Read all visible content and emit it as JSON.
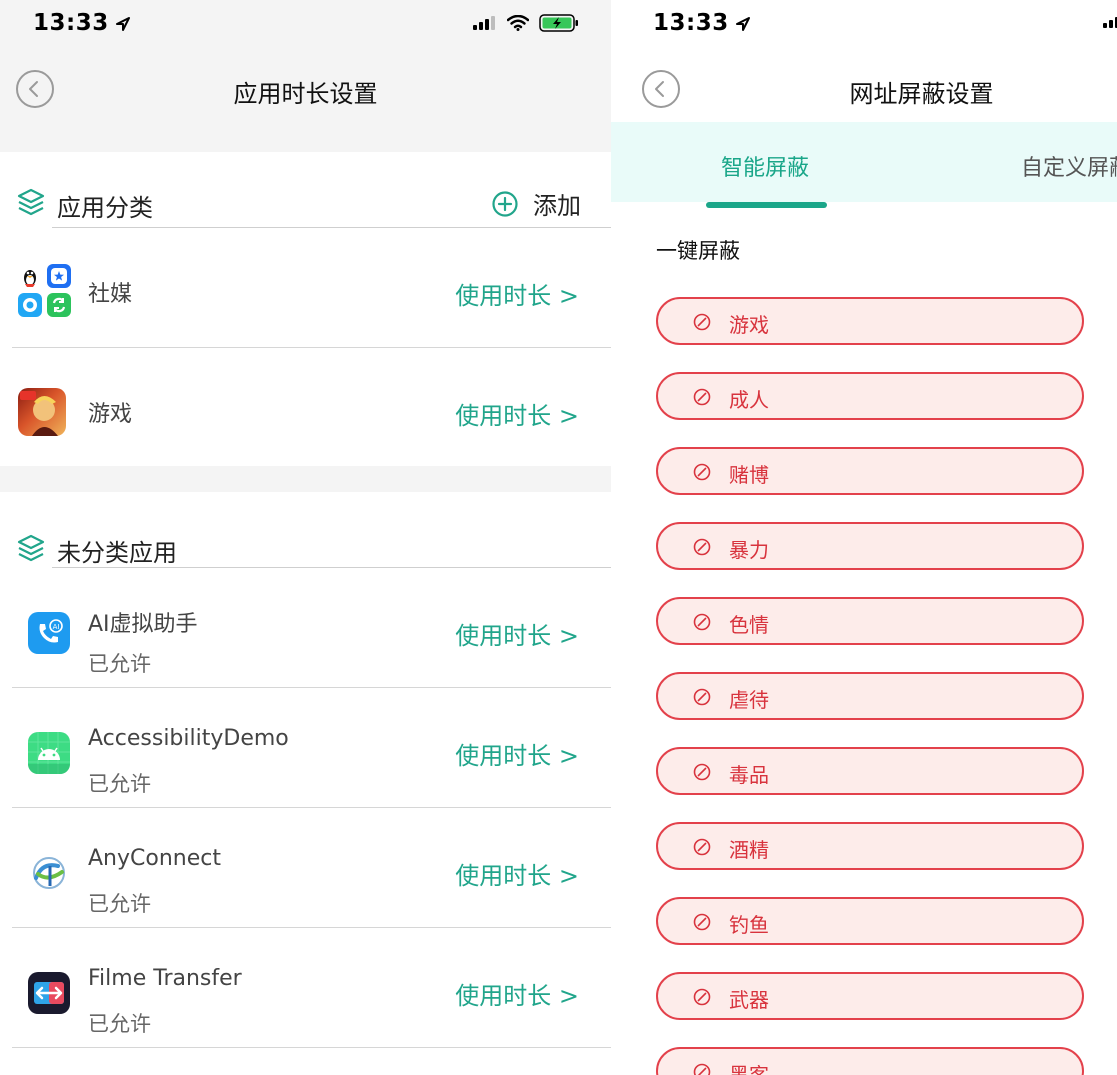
{
  "status": {
    "time": "13:33"
  },
  "left": {
    "title": "应用时长设置",
    "categorized": {
      "title": "应用分类",
      "add_label": "添加",
      "rows": [
        {
          "name": "社媒",
          "action": "使用时长 >"
        },
        {
          "name": "游戏",
          "action": "使用时长 >"
        }
      ]
    },
    "uncategorized": {
      "title": "未分类应用",
      "rows": [
        {
          "name": "AI虚拟助手",
          "status": "已允许",
          "action": "使用时长 >"
        },
        {
          "name": "AccessibilityDemo",
          "status": "已允许",
          "action": "使用时长 >"
        },
        {
          "name": "AnyConnect",
          "status": "已允许",
          "action": "使用时长 >"
        },
        {
          "name": "Filme Transfer",
          "status": "已允许",
          "action": "使用时长 >"
        }
      ]
    }
  },
  "right": {
    "title": "网址屏蔽设置",
    "tabs": [
      "智能屏蔽",
      "自定义屏蔽"
    ],
    "section_label": "一键屏蔽",
    "chips": [
      "游戏",
      "成人",
      "赌博",
      "暴力",
      "色情",
      "虐待",
      "毒品",
      "酒精",
      "钓鱼",
      "武器",
      "黑客"
    ]
  },
  "colors": {
    "accent": "#21a58b",
    "chip_border": "#e3414b",
    "chip_bg": "#fdecea",
    "chip_text": "#d8333d",
    "tab_bg": "#e9fbf9"
  },
  "icons": {
    "back": "chevron-left-circle-icon",
    "layers": "layers-icon",
    "add": "plus-circle-icon",
    "block": "block-icon"
  }
}
